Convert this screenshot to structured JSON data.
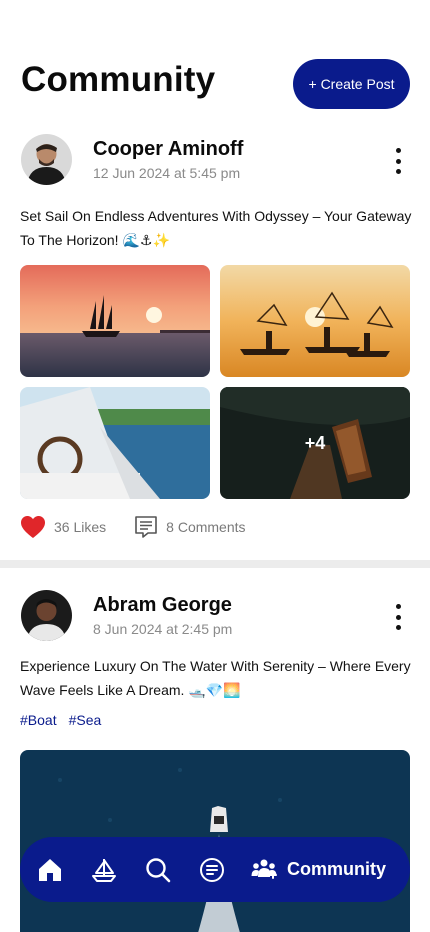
{
  "header": {
    "title": "Community",
    "create_button": "+ Create Post"
  },
  "posts": [
    {
      "author": "Cooper Aminoff",
      "timestamp": "12 Jun 2024 at 5:45 pm",
      "caption": "Set Sail On Endless Adventures With Odyssey – Your Gateway To The Horizon! 🌊⚓✨",
      "images": [
        "sailboat-at-sunset",
        "fishermen-with-nets",
        "boat-helm-on-lake",
        "boat-at-dock"
      ],
      "more_images": "+4",
      "likes": "36 Likes",
      "comments": "8 Comments"
    },
    {
      "author": "Abram George",
      "timestamp": "8 Jun 2024 at 2:45 pm",
      "caption": "Experience Luxury On The Water With Serenity – Where Every Wave Feels Like A Dream. 🛥️💎🌅",
      "tags": [
        "#Boat",
        "#Sea"
      ],
      "images": [
        "speedboat-aerial"
      ]
    }
  ],
  "nav": {
    "items": [
      "home-icon",
      "sailboat-icon",
      "search-icon",
      "list-icon"
    ],
    "active_label": "Community"
  },
  "colors": {
    "brand": "#0a1b8c",
    "like": "#e0262a",
    "muted": "#8a8a8a"
  }
}
